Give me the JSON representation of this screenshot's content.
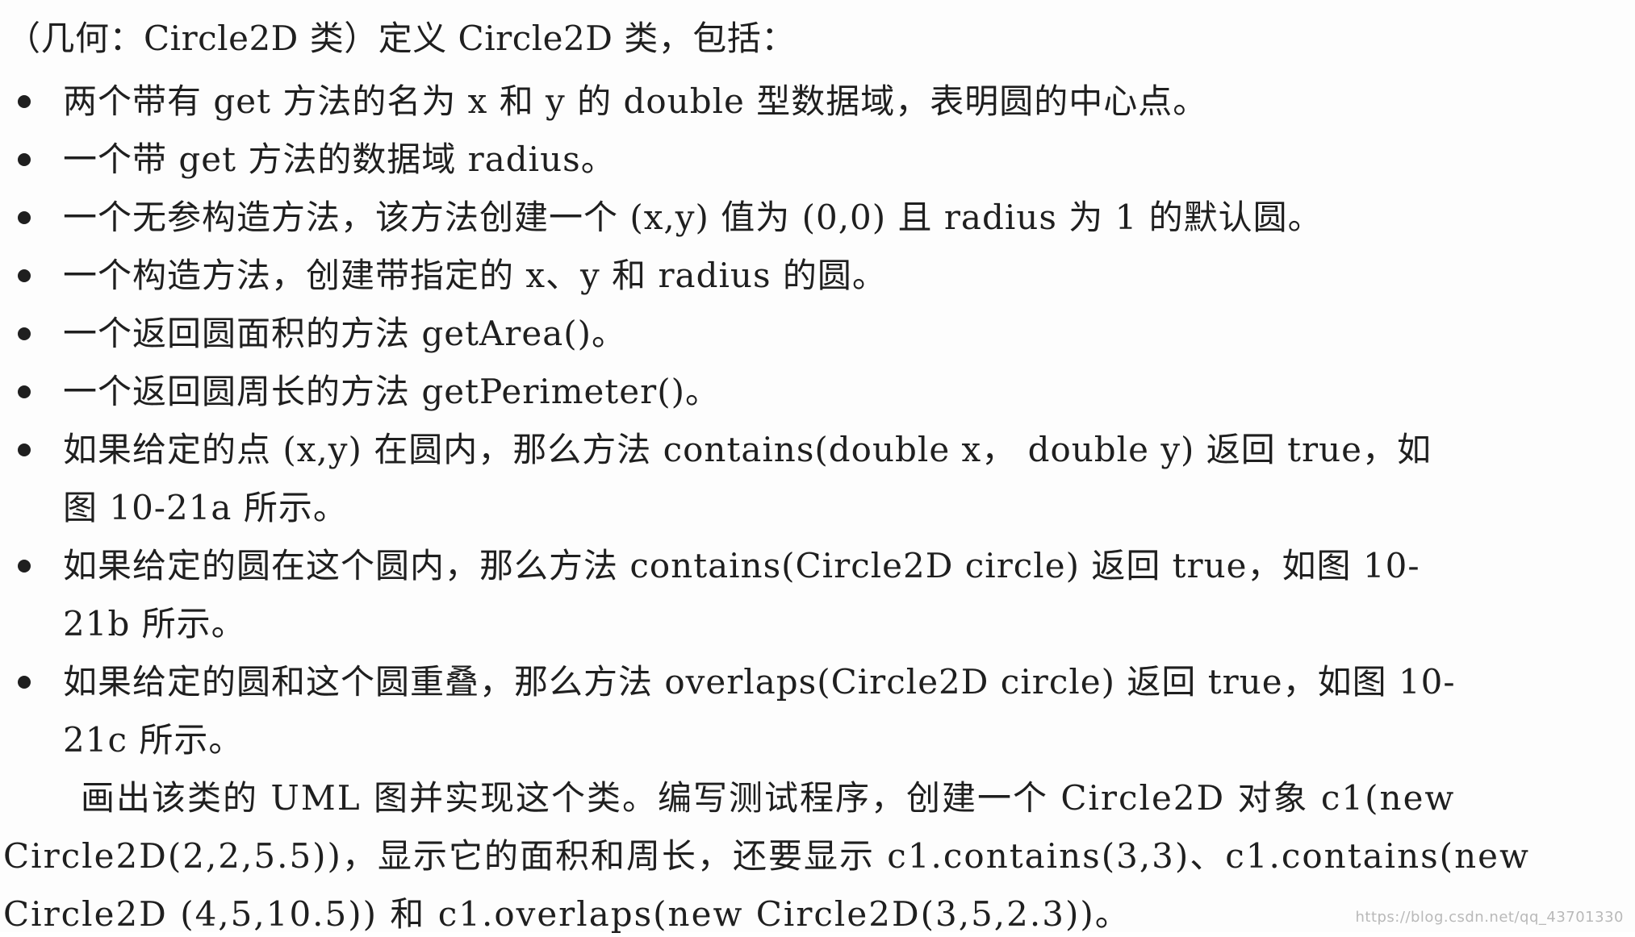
{
  "title_line": "（几何：Circle2D 类）定义 Circle2D 类，包括：",
  "bullets": [
    {
      "line1": "两个带有 get 方法的名为 x 和 y 的 double 型数据域，表明圆的中心点。",
      "line2": ""
    },
    {
      "line1": "一个带 get 方法的数据域 radius。",
      "line2": ""
    },
    {
      "line1": "一个无参构造方法，该方法创建一个 (x,y) 值为 (0,0) 且 radius 为 1 的默认圆。",
      "line2": ""
    },
    {
      "line1": "一个构造方法，创建带指定的 x、y 和 radius 的圆。",
      "line2": ""
    },
    {
      "line1": "一个返回圆面积的方法 getArea()。",
      "line2": ""
    },
    {
      "line1": "一个返回圆周长的方法 getPerimeter()。",
      "line2": ""
    },
    {
      "line1": "如果给定的点 (x,y) 在圆内，那么方法 contains(double  x， double  y) 返回 true，如",
      "line2": "图 10-21a 所示。"
    },
    {
      "line1": "如果给定的圆在这个圆内，那么方法 contains(Circle2D  circle) 返回 true，如图 10-",
      "line2": "21b 所示。"
    },
    {
      "line1": "如果给定的圆和这个圆重叠，那么方法 overlaps(Circle2D  circle) 返回 true，如图 10-",
      "line2": "21c 所示。"
    }
  ],
  "paragraph": {
    "line1": "画出该类的 UML 图并实现这个类。编写测试程序，创建一个 Circle2D 对象 c1(new",
    "line2": "Circle2D(2,2,5.5))，显示它的面积和周长，还要显示 c1.contains(3,3)、c1.contains(new",
    "line3": "Circle2D (4,5,10.5)) 和 c1.overlaps(new Circle2D(3,5,2.3))。"
  },
  "watermark": "https://blog.csdn.net/qq_43701330"
}
